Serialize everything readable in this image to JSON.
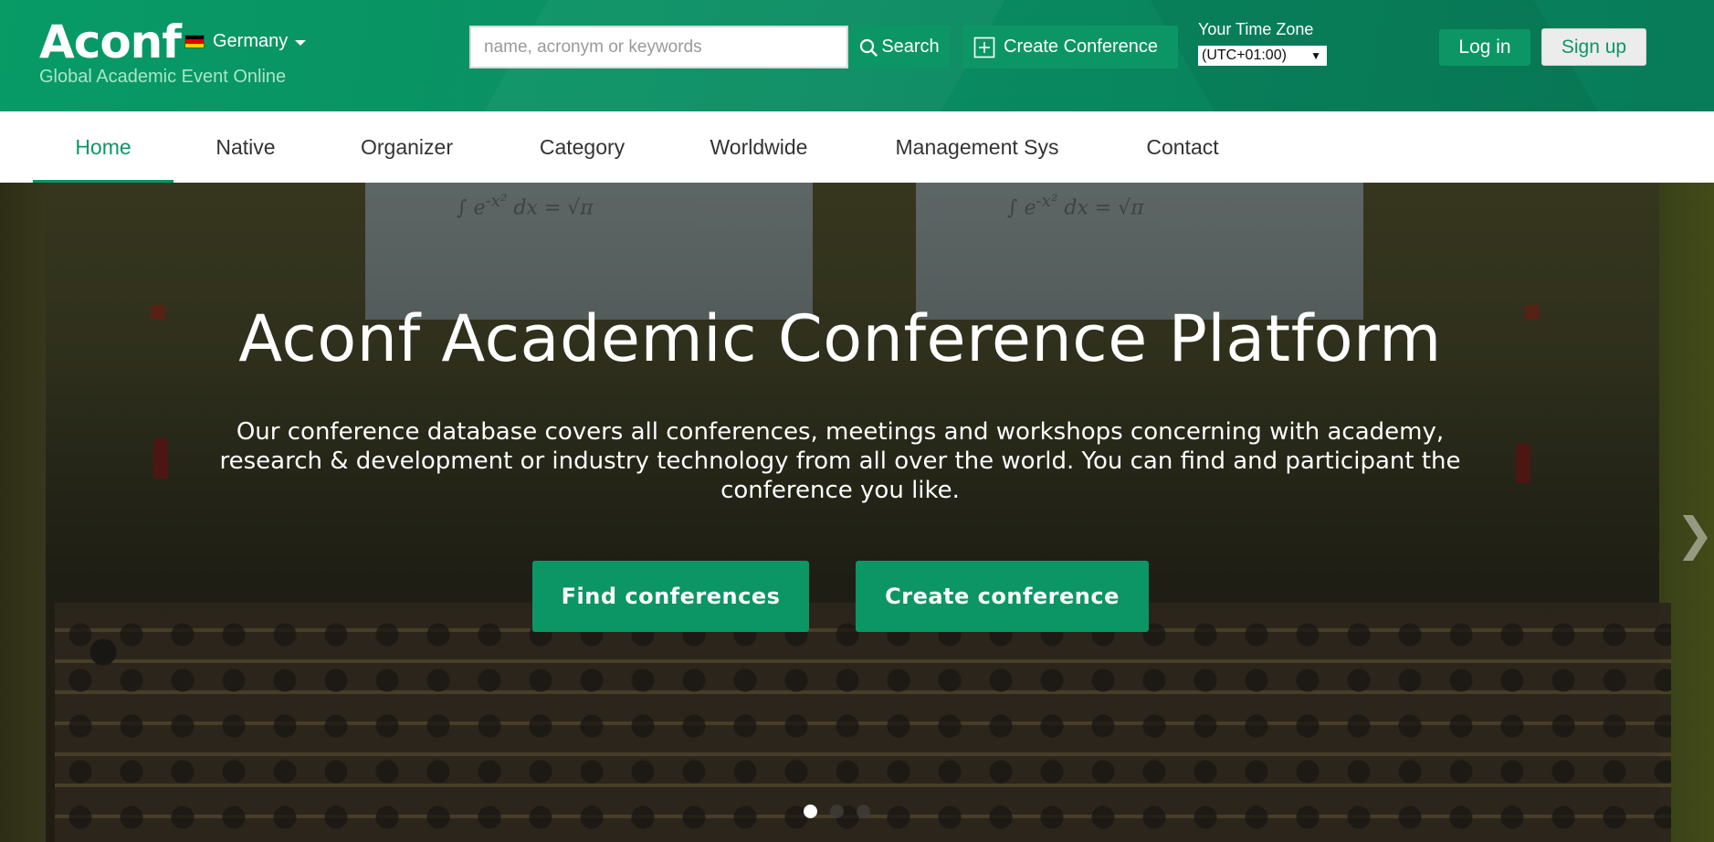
{
  "brand": {
    "logo": "Aconf",
    "tagline": "Global Academic Event Online",
    "accent_color": "#0c9665"
  },
  "header": {
    "country": {
      "label": "Germany",
      "flag_icon": "germany-flag-icon",
      "flag_colors": [
        "#000000",
        "#dd0000",
        "#ffce00"
      ]
    },
    "search": {
      "placeholder": "name, acronym or keywords",
      "value": "",
      "button_label": "Search",
      "icon": "search-icon"
    },
    "create_conference": {
      "label": "Create Conference",
      "icon": "plus-square-icon"
    },
    "timezone": {
      "label": "Your Time Zone",
      "selected": "(UTC+01:00)",
      "arrow": "▼"
    },
    "login_label": "Log in",
    "signup_label": "Sign up"
  },
  "nav": {
    "items": [
      {
        "label": "Home",
        "active": true
      },
      {
        "label": "Native",
        "active": false
      },
      {
        "label": "Organizer",
        "active": false
      },
      {
        "label": "Category",
        "active": false
      },
      {
        "label": "Worldwide",
        "active": false
      },
      {
        "label": "Management Sys",
        "active": false
      },
      {
        "label": "Contact",
        "active": false
      }
    ]
  },
  "hero": {
    "title": "Aconf Academic Conference Platform",
    "description": "Our conference database covers all conferences, meetings and workshops concerning with academy, research & development or industry technology from all over the world. You can find and participant the conference you like.",
    "find_button": "Find conferences",
    "create_button": "Create conference",
    "next_icon": "chevron-right-icon",
    "next_glyph": "❯",
    "slides": {
      "count": 3,
      "active_index": 0
    }
  }
}
